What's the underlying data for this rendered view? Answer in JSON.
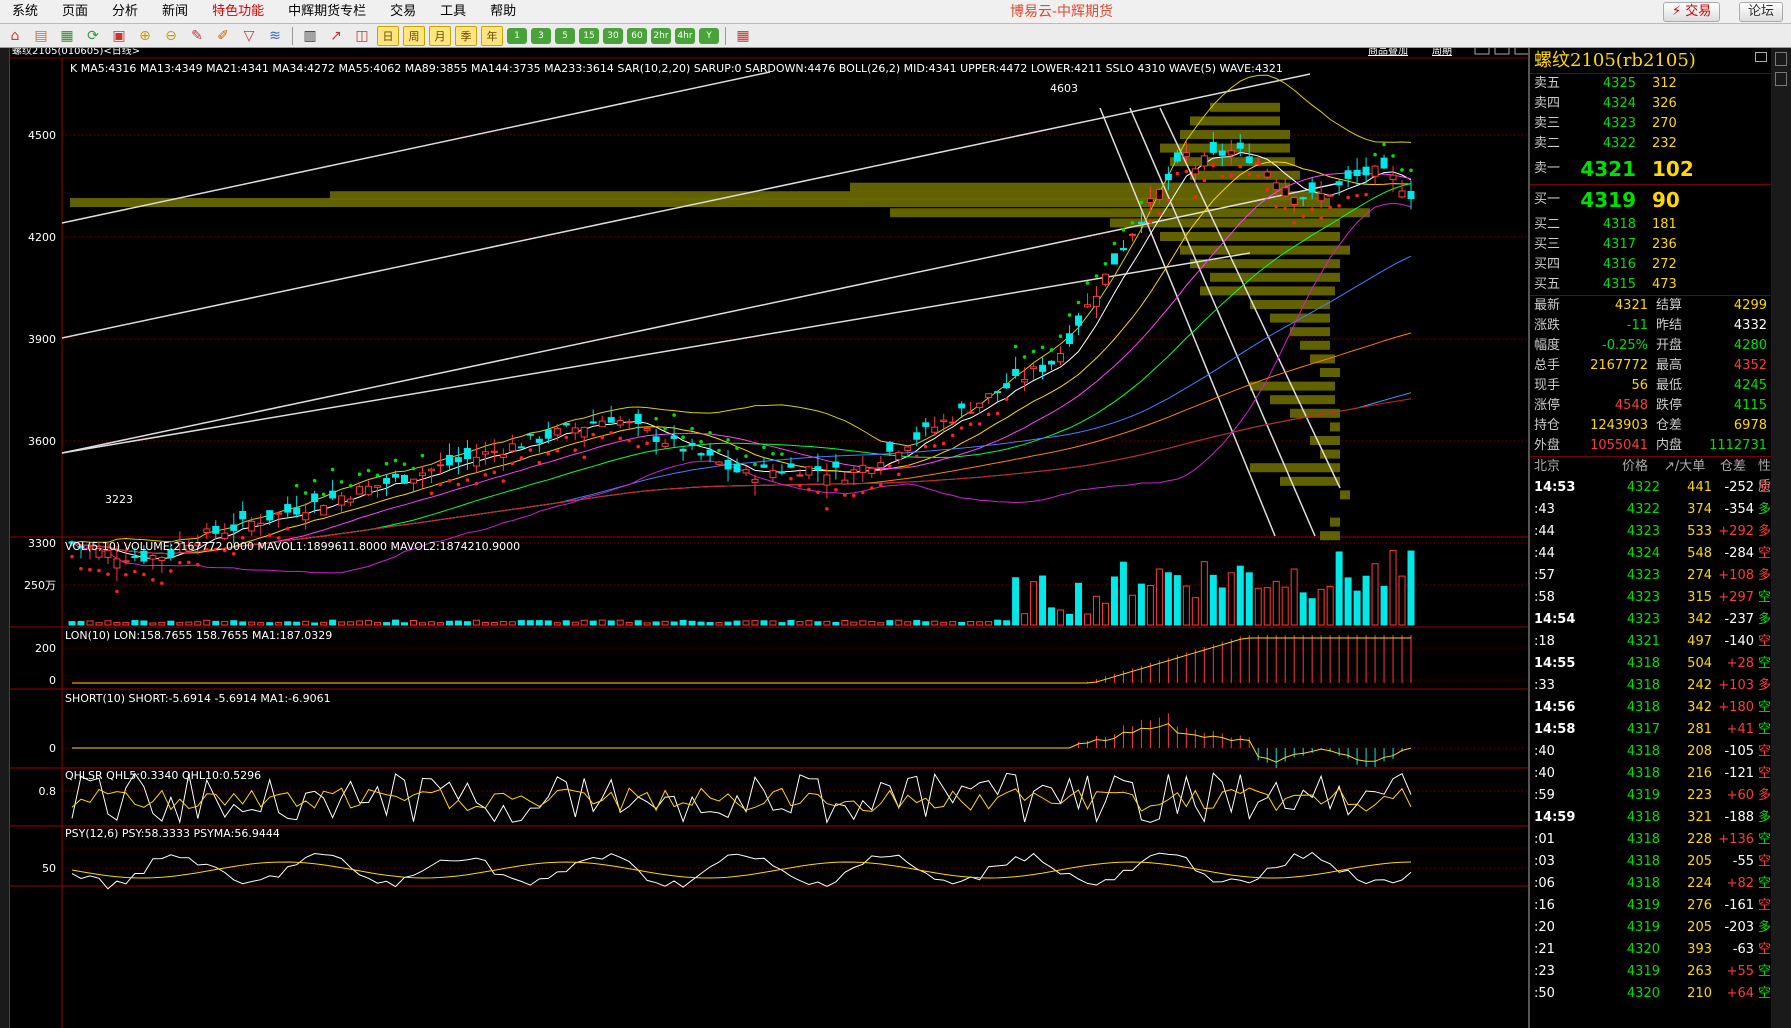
{
  "menu": {
    "items": [
      {
        "label": "系统",
        "special": false
      },
      {
        "label": "页面",
        "special": false
      },
      {
        "label": "分析",
        "special": false
      },
      {
        "label": "新闻",
        "special": false
      },
      {
        "label": "特色功能",
        "special": true
      },
      {
        "label": "中辉期货专栏",
        "special": false
      },
      {
        "label": "交易",
        "special": false
      },
      {
        "label": "工具",
        "special": false
      },
      {
        "label": "帮助",
        "special": false
      }
    ],
    "app_title": "博易云-中辉期货",
    "trade_button": "⚡ 交易",
    "forum_button": "论坛"
  },
  "toolbar": {
    "period_buttons": [
      "日",
      "周",
      "月",
      "季",
      "年"
    ],
    "num_buttons": [
      "1",
      "3",
      "5",
      "15",
      "30",
      "60",
      "2hr",
      "4hr",
      "Y"
    ]
  },
  "chart": {
    "instrument_label": "螺纹2105(010605)<日线>",
    "tabs": [
      "商品叠加",
      "周期"
    ],
    "main_indicator": "K  MA5:4316  MA13:4349  MA21:4341  MA34:4272  MA55:4062  MA89:3855  MA144:3735  MA233:3614  SAR(10,2,20)  SARUP:0  SARDOWN:4476  BOLL(26,2)  MID:4341  UPPER:4472  LOWER:4211  SSLO 4310  WAVE(5)  WAVE:4321",
    "yaxis_main": [
      "4500",
      "4200",
      "3900",
      "3600",
      "3300"
    ],
    "high_label": "4603",
    "low_label": "3223",
    "vol_indicator": "VOL(5,10)  VOLUME:2167772.0000  MAVOL1:1899611.8000  MAVOL2:1874210.9000",
    "vol_axis": "250万",
    "lon_indicator": "LON(10)  LON:158.7655  158.7655  MA1:187.0329",
    "lon_axis": [
      "200",
      "0"
    ],
    "short_indicator": "SHORT(10)  SHORT:-5.6914  -5.6914  MA1:-6.9061",
    "short_axis": "0",
    "qhlsr_indicator": "QHLSR  QHL5:0.3340  QHL10:0.5296",
    "qhlsr_axis": "0.8",
    "psy_indicator": "PSY(12,6)  PSY:58.3333  PSYMA:56.9444",
    "psy_axis": "50"
  },
  "panel": {
    "title": "螺纹2105(rb2105)",
    "asks": [
      {
        "label": "卖五",
        "price": "4325",
        "vol": "312"
      },
      {
        "label": "卖四",
        "price": "4324",
        "vol": "326"
      },
      {
        "label": "卖三",
        "price": "4323",
        "vol": "270"
      },
      {
        "label": "卖二",
        "price": "4322",
        "vol": "232"
      }
    ],
    "ask1": {
      "label": "卖一",
      "price": "4321",
      "vol": "102"
    },
    "bid1": {
      "label": "买一",
      "price": "4319",
      "vol": "90"
    },
    "bids": [
      {
        "label": "买二",
        "price": "4318",
        "vol": "181"
      },
      {
        "label": "买三",
        "price": "4317",
        "vol": "236"
      },
      {
        "label": "买四",
        "price": "4316",
        "vol": "272"
      },
      {
        "label": "买五",
        "price": "4315",
        "vol": "473"
      }
    ],
    "quotes": [
      {
        "l1": "最新",
        "v1": "4321",
        "c1": "yellow",
        "l2": "结算",
        "v2": "4299",
        "c2": "yellow"
      },
      {
        "l1": "涨跌",
        "v1": "-11",
        "c1": "green",
        "l2": "昨结",
        "v2": "4332",
        "c2": "white"
      },
      {
        "l1": "幅度",
        "v1": "-0.25%",
        "c1": "green",
        "l2": "开盘",
        "v2": "4280",
        "c2": "green"
      },
      {
        "l1": "总手",
        "v1": "2167772",
        "c1": "yellow",
        "l2": "最高",
        "v2": "4352",
        "c2": "red"
      },
      {
        "l1": "现手",
        "v1": "56",
        "c1": "yellow",
        "l2": "最低",
        "v2": "4245",
        "c2": "green"
      },
      {
        "l1": "涨停",
        "v1": "4548",
        "c1": "red",
        "l2": "跌停",
        "v2": "4115",
        "c2": "green"
      },
      {
        "l1": "持仓",
        "v1": "1243903",
        "c1": "yellow",
        "l2": "仓差",
        "v2": "6978",
        "c2": "yellow"
      },
      {
        "l1": "外盘",
        "v1": "1055041",
        "c1": "red",
        "l2": "内盘",
        "v2": "1112731",
        "c2": "green"
      }
    ],
    "trade_header": {
      "loc": "北京",
      "price": "价格",
      "vol": "↗/大单",
      "chg": "仓差",
      "nature": "性质"
    },
    "trades": [
      {
        "t": "14:53",
        "bold": true,
        "p": "4322",
        "pc": "green",
        "v": "441",
        "c": "-252",
        "n": "空平",
        "nc": "red"
      },
      {
        "t": ":43",
        "bold": false,
        "p": "4322",
        "pc": "green",
        "v": "374",
        "c": "-354",
        "n": "多平",
        "nc": "green"
      },
      {
        "t": ":44",
        "bold": false,
        "p": "4323",
        "pc": "green",
        "v": "533",
        "c": "+292",
        "n": "多开",
        "nc": "red"
      },
      {
        "t": ":44",
        "bold": false,
        "p": "4324",
        "pc": "green",
        "v": "548",
        "c": "-284",
        "n": "空平",
        "nc": "red"
      },
      {
        "t": ":57",
        "bold": false,
        "p": "4323",
        "pc": "green",
        "v": "274",
        "c": "+108",
        "n": "多开",
        "nc": "red"
      },
      {
        "t": ":58",
        "bold": false,
        "p": "4323",
        "pc": "green",
        "v": "315",
        "c": "+297",
        "n": "空开",
        "nc": "green"
      },
      {
        "t": "14:54",
        "bold": true,
        "p": "4323",
        "pc": "green",
        "v": "342",
        "c": "-237",
        "n": "多平",
        "nc": "green"
      },
      {
        "t": ":18",
        "bold": false,
        "p": "4321",
        "pc": "green",
        "v": "497",
        "c": "-140",
        "n": "空平",
        "nc": "red"
      },
      {
        "t": "14:55",
        "bold": true,
        "p": "4318",
        "pc": "green",
        "v": "504",
        "c": "+28",
        "n": "空开",
        "nc": "green"
      },
      {
        "t": ":33",
        "bold": false,
        "p": "4318",
        "pc": "green",
        "v": "242",
        "c": "+103",
        "n": "多开",
        "nc": "red"
      },
      {
        "t": "14:56",
        "bold": true,
        "p": "4318",
        "pc": "green",
        "v": "342",
        "c": "+180",
        "n": "空开",
        "nc": "green"
      },
      {
        "t": "14:58",
        "bold": true,
        "p": "4317",
        "pc": "green",
        "v": "281",
        "c": "+41",
        "n": "空开",
        "nc": "green"
      },
      {
        "t": ":40",
        "bold": false,
        "p": "4318",
        "pc": "green",
        "v": "208",
        "c": "-105",
        "n": "空平",
        "nc": "red"
      },
      {
        "t": ":40",
        "bold": false,
        "p": "4318",
        "pc": "green",
        "v": "216",
        "c": "-121",
        "n": "空平",
        "nc": "red"
      },
      {
        "t": ":59",
        "bold": false,
        "p": "4319",
        "pc": "green",
        "v": "223",
        "c": "+60",
        "n": "多开",
        "nc": "red"
      },
      {
        "t": "14:59",
        "bold": true,
        "p": "4318",
        "pc": "green",
        "v": "321",
        "c": "-188",
        "n": "多平",
        "nc": "green"
      },
      {
        "t": ":01",
        "bold": false,
        "p": "4318",
        "pc": "green",
        "v": "228",
        "c": "+136",
        "n": "空开",
        "nc": "green"
      },
      {
        "t": ":03",
        "bold": false,
        "p": "4318",
        "pc": "green",
        "v": "205",
        "c": "-55",
        "n": "空平",
        "nc": "red"
      },
      {
        "t": ":06",
        "bold": false,
        "p": "4318",
        "pc": "green",
        "v": "224",
        "c": "+82",
        "n": "空开",
        "nc": "green"
      },
      {
        "t": ":16",
        "bold": false,
        "p": "4319",
        "pc": "green",
        "v": "276",
        "c": "-161",
        "n": "空平",
        "nc": "red"
      },
      {
        "t": ":20",
        "bold": false,
        "p": "4319",
        "pc": "green",
        "v": "205",
        "c": "-203",
        "n": "多平",
        "nc": "green"
      },
      {
        "t": ":21",
        "bold": false,
        "p": "4320",
        "pc": "green",
        "v": "393",
        "c": "-63",
        "n": "空平",
        "nc": "red"
      },
      {
        "t": ":23",
        "bold": false,
        "p": "4319",
        "pc": "green",
        "v": "263",
        "c": "+55",
        "n": "空开",
        "nc": "green"
      },
      {
        "t": ":50",
        "bold": false,
        "p": "4320",
        "pc": "green",
        "v": "210",
        "c": "+64",
        "n": "空开",
        "nc": "green"
      }
    ]
  }
}
